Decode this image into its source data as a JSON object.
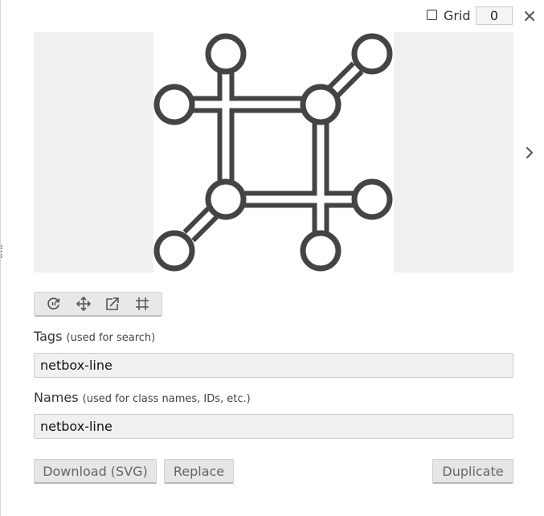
{
  "grid": {
    "label": "Grid",
    "checked": false,
    "value": "0"
  },
  "preview": {
    "icon_name": "netbox-line-icon"
  },
  "tags": {
    "label": "Tags",
    "hint": "(used for search)",
    "value": "netbox-line"
  },
  "names": {
    "label": "Names",
    "hint": "(used for class names, IDs, etc.)",
    "value": "netbox-line"
  },
  "buttons": {
    "download": "Download (SVG)",
    "replace": "Replace",
    "duplicate": "Duplicate"
  },
  "colors": {
    "icon_stroke": "#444444",
    "preview_bg": "#f0f0f0",
    "button_text": "#666666"
  }
}
